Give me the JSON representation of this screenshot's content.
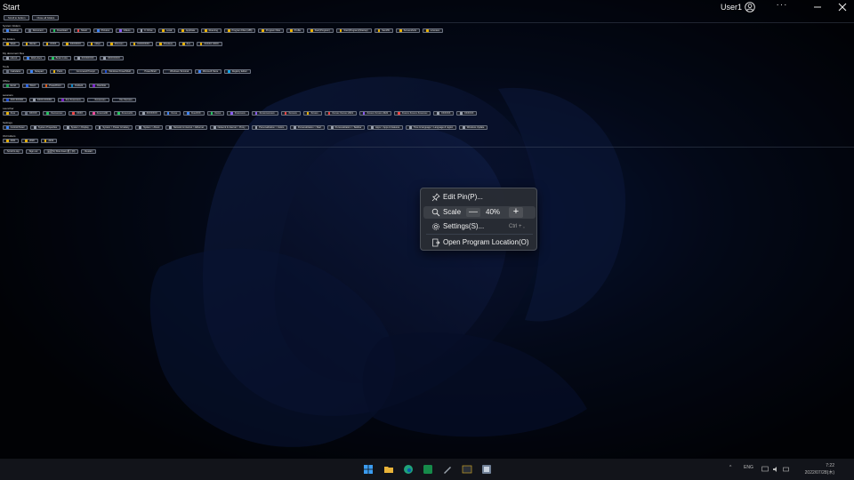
{
  "window": {
    "title": "Start",
    "user": "User1",
    "more_label": "···"
  },
  "top_buttons": [
    {
      "label": "Scroll to bottom"
    },
    {
      "label": "Close all folders"
    }
  ],
  "groups": [
    {
      "title": "System folders",
      "items": [
        {
          "label": "Desktop",
          "color": "#3b82f6"
        },
        {
          "label": "Document",
          "color": "#6b7280"
        },
        {
          "label": "Download",
          "color": "#22c55e"
        },
        {
          "label": "Music",
          "color": "#ef4444"
        },
        {
          "label": "Pictures",
          "color": "#3b82f6"
        },
        {
          "label": "Videos",
          "color": "#8b5cf6"
        },
        {
          "label": "C: Drive",
          "color": "#9ca3af"
        },
        {
          "label": "Local",
          "color": "#eab308"
        },
        {
          "label": "AppData",
          "color": "#eab308"
        },
        {
          "label": "Roaming",
          "color": "#eab308"
        },
        {
          "label": "Program Files (x86)",
          "color": "#eab308"
        },
        {
          "label": "Program Files",
          "color": "#eab308"
        },
        {
          "label": "Profile",
          "color": "#eab308"
        },
        {
          "label": "Start(Program)",
          "color": "#eab308"
        },
        {
          "label": "Start(Program)(Startup)",
          "color": "#eab308"
        },
        {
          "label": "SendTo",
          "color": "#eab308"
        },
        {
          "label": "Screenshots",
          "color": "#eab308"
        },
        {
          "label": "Licenses",
          "color": "#eab308"
        }
      ]
    },
    {
      "title": "My folders",
      "items": [
        {
          "label": "Work",
          "color": "#eab308"
        },
        {
          "label": "Work2",
          "color": "#eab308"
        },
        {
          "label": "XXXX",
          "color": "#eab308"
        },
        {
          "label": "XXXXXXX",
          "color": "#eab308"
        },
        {
          "label": "Other",
          "color": "#eab308"
        },
        {
          "label": "XXxxxxx",
          "color": "#eab308"
        },
        {
          "label": "XXXXXXXX",
          "color": "#eab308"
        },
        {
          "label": "XXxdoos",
          "color": "#eab308"
        },
        {
          "label": "Xxx",
          "color": "#eab308"
        },
        {
          "label": "XXXXX XXXX",
          "color": "#eab308"
        }
      ]
    },
    {
      "title": "My document files",
      "items": [
        {
          "label": "Life.txt",
          "color": "#9ca3af"
        },
        {
          "label": "Work.docx",
          "color": "#3b82f6"
        },
        {
          "label": "Book 4.xlsx",
          "color": "#22c55e"
        },
        {
          "label": "XXXXXXXX",
          "color": "#9ca3af"
        },
        {
          "label": "XXXXXXXX",
          "color": "#9ca3af"
        }
      ]
    },
    {
      "title": "Tools",
      "items": [
        {
          "label": "Calculator",
          "color": "#6b7280"
        },
        {
          "label": "Notepad",
          "color": "#3b82f6"
        },
        {
          "label": "Paint",
          "color": "#eab308"
        },
        {
          "label": "Command Prompt",
          "color": "#111827"
        },
        {
          "label": "Windows PowerShell",
          "color": "#1d4ed8"
        },
        {
          "label": "PowerShell",
          "color": "#111827"
        },
        {
          "label": "Windows Terminal",
          "color": "#111827"
        },
        {
          "label": "Microsoft Store",
          "color": "#3b82f6"
        },
        {
          "label": "Registry Editor",
          "color": "#0ea5e9"
        }
      ]
    },
    {
      "title": "Office",
      "items": [
        {
          "label": "Excel",
          "color": "#16a34a"
        },
        {
          "label": "Word",
          "color": "#2563eb"
        },
        {
          "label": "PowerPoint",
          "color": "#ea580c"
        },
        {
          "label": "Outlook",
          "color": "#0284c7"
        },
        {
          "label": "OneNote",
          "color": "#7e22ce"
        }
      ]
    },
    {
      "title": "sessions",
      "items": [
        {
          "label": "XXX XXXXX",
          "color": "#1d4ed8"
        },
        {
          "label": "XXXX XXXXX",
          "color": "#9ca3af"
        },
        {
          "label": "Xxx Xxxxxxxxx",
          "color": "#7e22ce"
        },
        {
          "label": "Xxxxxxxxx",
          "color": "#111827"
        },
        {
          "label": "Xxx Xxxxxxx",
          "color": "#111827"
        }
      ]
    },
    {
      "title": "Launcher",
      "items": [
        {
          "label": "Xxxx",
          "color": "#eab308"
        },
        {
          "label": "XXXXX",
          "color": "#6b7280"
        },
        {
          "label": "Xxxxxxxxxx",
          "color": "#22c55e"
        },
        {
          "label": "XXXX",
          "color": "#ef4444"
        },
        {
          "label": "Xxxxxxx00",
          "color": "#ec4899"
        },
        {
          "label": "Xxxxxxx01",
          "color": "#22c55e"
        },
        {
          "label": "XXXXXXX",
          "color": "#9ca3af"
        },
        {
          "label": "Xxxxx",
          "color": "#3b82f6"
        },
        {
          "label": "XxxxXXX",
          "color": "#3b82f6"
        },
        {
          "label": "Xxxxx",
          "color": "#22c55e"
        },
        {
          "label": "Xxxxxxxxx",
          "color": "#8b5cf6"
        },
        {
          "label": "Xxxxxxxxxxxxx",
          "color": "#8b5cf6"
        },
        {
          "label": "Xxxxxxx",
          "color": "#ef4444"
        },
        {
          "label": "Xxxxxx",
          "color": "#eab308"
        },
        {
          "label": "Xxxxxx Xxxxxx 2019",
          "color": "#ef4444"
        },
        {
          "label": "Xxxxxx Xxxxxx 2022",
          "color": "#8b5cf6"
        },
        {
          "label": "Xxxxxx Xxxxxx Xxxxxxxx",
          "color": "#ef4444"
        },
        {
          "label": "XXXXXX",
          "color": "#9ca3af"
        },
        {
          "label": "XXXXXX",
          "color": "#9ca3af"
        }
      ]
    },
    {
      "title": "Settings",
      "items": [
        {
          "label": "Control Panel",
          "color": "#3b82f6"
        },
        {
          "label": "System Properties",
          "color": "#9ca3af"
        },
        {
          "label": "System > Display",
          "color": "#9ca3af"
        },
        {
          "label": "System > Power & battery",
          "color": "#9ca3af"
        },
        {
          "label": "System > About",
          "color": "#9ca3af"
        },
        {
          "label": "Network & internet > Ethernet",
          "color": "#9ca3af"
        },
        {
          "label": "Network & internet > Proxy",
          "color": "#9ca3af"
        },
        {
          "label": "Personalization > Colors",
          "color": "#9ca3af"
        },
        {
          "label": "Personalization > Start",
          "color": "#9ca3af"
        },
        {
          "label": "Personalization > Taskbar",
          "color": "#9ca3af"
        },
        {
          "label": "Apps > Apps & features",
          "color": "#9ca3af"
        },
        {
          "label": "Time & language > Language & region",
          "color": "#9ca3af"
        },
        {
          "label": "Windows Update",
          "color": "#9ca3af"
        }
      ]
    },
    {
      "title": "Old folders",
      "items": [
        {
          "label": "2021",
          "color": "#eab308"
        },
        {
          "label": "2020",
          "color": "#eab308"
        },
        {
          "label": "2019",
          "color": "#eab308"
        }
      ]
    }
  ],
  "bottom_buttons": [
    {
      "label": "Scroll to top"
    },
    {
      "label": "Sign out"
    },
    {
      "label": "設定(S) Shut down 終了(D)"
    },
    {
      "label": "Restart"
    }
  ],
  "context_menu": {
    "edit_label": "Edit Pin(P)...",
    "scale_label": "Scale",
    "scale_minus": "—",
    "scale_value": "40%",
    "scale_plus": "+",
    "settings_label": "Settings(S)...",
    "settings_shortcut": "Ctrl + ,",
    "open_location_label": "Open Program Location(O)"
  },
  "tray": {
    "chevron": "^",
    "lang": "ENG",
    "time": "7:22",
    "date": "2022/07/28(木)"
  }
}
